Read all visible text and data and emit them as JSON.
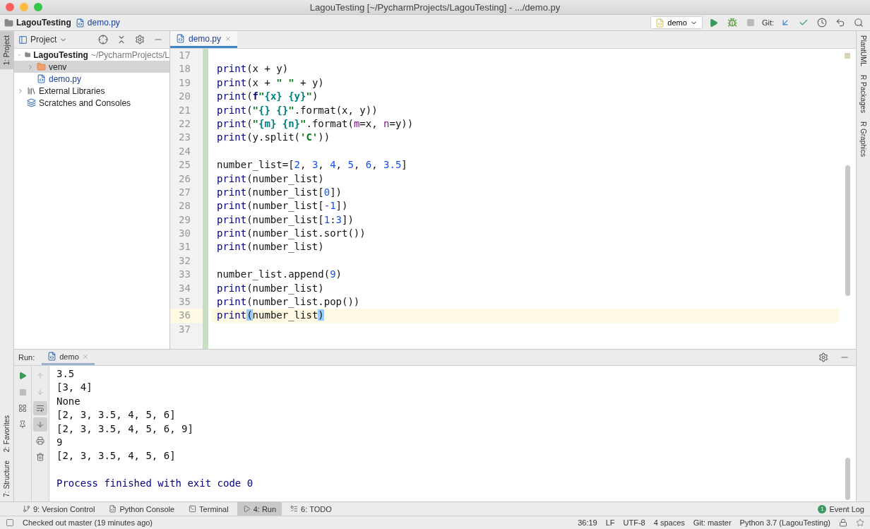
{
  "window": {
    "title": "LagouTesting [~/PycharmProjects/LagouTesting] - .../demo.py"
  },
  "nav_bar": {
    "breadcrumbs": [
      {
        "label": "LagouTesting",
        "kind": "folder"
      },
      {
        "label": "demo.py",
        "kind": "file"
      }
    ],
    "run_config": "demo",
    "git_label": "Git:"
  },
  "left_strip": [
    {
      "label": "1: Project",
      "selected": true,
      "kind": "top"
    },
    {
      "label": "2: Favorites",
      "selected": false,
      "kind": "bottom"
    },
    {
      "label": "7: Structure",
      "selected": false,
      "kind": "bottom"
    }
  ],
  "right_strip": [
    {
      "label": "PlantUML"
    },
    {
      "label": "R Packages"
    },
    {
      "label": "R Graphics"
    }
  ],
  "project_panel": {
    "title": "Project",
    "tree": [
      {
        "label": "LagouTesting",
        "path": "~/PycharmProjects/L",
        "kind": "project",
        "expanded": true,
        "selected": false,
        "children": [
          {
            "label": "venv",
            "kind": "folder",
            "expanded": false,
            "selected": true
          },
          {
            "label": "demo.py",
            "kind": "file",
            "selected": false
          }
        ]
      },
      {
        "label": "External Libraries",
        "kind": "library",
        "expanded": false,
        "selected": false
      },
      {
        "label": "Scratches and Consoles",
        "kind": "scratch",
        "selected": false
      }
    ]
  },
  "editor": {
    "tabs": [
      {
        "label": "demo.py",
        "selected": true
      }
    ],
    "lines": [
      {
        "number": "17",
        "current": false
      },
      {
        "number": "18",
        "current": false,
        "tokens": [
          {
            "text": "print",
            "kind": "builtin"
          },
          {
            "text": "(x + y)",
            "kind": "plain"
          }
        ]
      },
      {
        "number": "19",
        "current": false,
        "tokens": [
          {
            "text": "print",
            "kind": "builtin"
          },
          {
            "text": "(x + ",
            "kind": "plain"
          },
          {
            "text": "\" \"",
            "kind": "string"
          },
          {
            "text": " + y)",
            "kind": "plain"
          }
        ]
      },
      {
        "number": "20",
        "current": false,
        "tokens": [
          {
            "text": "print",
            "kind": "builtin"
          },
          {
            "text": "(",
            "kind": "plain"
          },
          {
            "text": "f",
            "kind": "fprefix"
          },
          {
            "text": "\"",
            "kind": "string"
          },
          {
            "text": "{x} {y}",
            "kind": "brace"
          },
          {
            "text": "\"",
            "kind": "string"
          },
          {
            "text": ")",
            "kind": "plain"
          }
        ]
      },
      {
        "number": "21",
        "current": false,
        "tokens": [
          {
            "text": "print",
            "kind": "builtin"
          },
          {
            "text": "(",
            "kind": "plain"
          },
          {
            "text": "\"",
            "kind": "string"
          },
          {
            "text": "{} {}",
            "kind": "brace"
          },
          {
            "text": "\"",
            "kind": "string"
          },
          {
            "text": ".format(x, y))",
            "kind": "plain"
          }
        ]
      },
      {
        "number": "22",
        "current": false,
        "tokens": [
          {
            "text": "print",
            "kind": "builtin"
          },
          {
            "text": "(",
            "kind": "plain"
          },
          {
            "text": "\"",
            "kind": "string"
          },
          {
            "text": "{m} {n}",
            "kind": "brace"
          },
          {
            "text": "\"",
            "kind": "string"
          },
          {
            "text": ".format(",
            "kind": "plain"
          },
          {
            "text": "m",
            "kind": "param"
          },
          {
            "text": "=x, ",
            "kind": "plain"
          },
          {
            "text": "n",
            "kind": "param"
          },
          {
            "text": "=y))",
            "kind": "plain"
          }
        ]
      },
      {
        "number": "23",
        "current": false,
        "tokens": [
          {
            "text": "print",
            "kind": "builtin"
          },
          {
            "text": "(y.split(",
            "kind": "plain"
          },
          {
            "text": "'C'",
            "kind": "string"
          },
          {
            "text": "))",
            "kind": "plain"
          }
        ]
      },
      {
        "number": "24",
        "current": false
      },
      {
        "number": "25",
        "current": false,
        "tokens": [
          {
            "text": "number_list=[",
            "kind": "plain"
          },
          {
            "text": "2",
            "kind": "number"
          },
          {
            "text": ", ",
            "kind": "plain"
          },
          {
            "text": "3",
            "kind": "number"
          },
          {
            "text": ", ",
            "kind": "plain"
          },
          {
            "text": "4",
            "kind": "number"
          },
          {
            "text": ", ",
            "kind": "plain"
          },
          {
            "text": "5",
            "kind": "number"
          },
          {
            "text": ", ",
            "kind": "plain"
          },
          {
            "text": "6",
            "kind": "number"
          },
          {
            "text": ", ",
            "kind": "plain"
          },
          {
            "text": "3.5",
            "kind": "number"
          },
          {
            "text": "]",
            "kind": "plain"
          }
        ]
      },
      {
        "number": "26",
        "current": false,
        "tokens": [
          {
            "text": "print",
            "kind": "builtin"
          },
          {
            "text": "(number_list)",
            "kind": "plain"
          }
        ]
      },
      {
        "number": "27",
        "current": false,
        "tokens": [
          {
            "text": "print",
            "kind": "builtin"
          },
          {
            "text": "(number_list[",
            "kind": "plain"
          },
          {
            "text": "0",
            "kind": "number"
          },
          {
            "text": "])",
            "kind": "plain"
          }
        ]
      },
      {
        "number": "28",
        "current": false,
        "tokens": [
          {
            "text": "print",
            "kind": "builtin"
          },
          {
            "text": "(number_list[",
            "kind": "plain"
          },
          {
            "text": "-1",
            "kind": "number"
          },
          {
            "text": "])",
            "kind": "plain"
          }
        ]
      },
      {
        "number": "29",
        "current": false,
        "tokens": [
          {
            "text": "print",
            "kind": "builtin"
          },
          {
            "text": "(number_list[",
            "kind": "plain"
          },
          {
            "text": "1",
            "kind": "number"
          },
          {
            "text": ":",
            "kind": "plain"
          },
          {
            "text": "3",
            "kind": "number"
          },
          {
            "text": "])",
            "kind": "plain"
          }
        ]
      },
      {
        "number": "30",
        "current": false,
        "tokens": [
          {
            "text": "print",
            "kind": "builtin"
          },
          {
            "text": "(number_list.sort())",
            "kind": "plain"
          }
        ]
      },
      {
        "number": "31",
        "current": false,
        "tokens": [
          {
            "text": "print",
            "kind": "builtin"
          },
          {
            "text": "(number_list)",
            "kind": "plain"
          }
        ]
      },
      {
        "number": "32",
        "current": false
      },
      {
        "number": "33",
        "current": false,
        "tokens": [
          {
            "text": "number_list.append(",
            "kind": "plain"
          },
          {
            "text": "9",
            "kind": "number"
          },
          {
            "text": ")",
            "kind": "plain"
          }
        ]
      },
      {
        "number": "34",
        "current": false,
        "tokens": [
          {
            "text": "print",
            "kind": "builtin"
          },
          {
            "text": "(number_list)",
            "kind": "plain"
          }
        ]
      },
      {
        "number": "35",
        "current": false,
        "tokens": [
          {
            "text": "print",
            "kind": "builtin"
          },
          {
            "text": "(number_list.pop())",
            "kind": "plain"
          }
        ]
      },
      {
        "number": "36",
        "current": true,
        "tokens": [
          {
            "text": "print",
            "kind": "builtin"
          },
          {
            "text": "(",
            "kind": "match"
          },
          {
            "text": "number_list",
            "kind": "plain"
          },
          {
            "text": ")",
            "kind": "match"
          }
        ]
      },
      {
        "number": "37",
        "current": false
      }
    ]
  },
  "run_panel": {
    "label": "Run:",
    "tabs": [
      {
        "label": "demo",
        "selected": true
      }
    ],
    "output": [
      {
        "text": "3.5",
        "kind": "stdout"
      },
      {
        "text": "[3, 4]",
        "kind": "stdout"
      },
      {
        "text": "None",
        "kind": "stdout"
      },
      {
        "text": "[2, 3, 3.5, 4, 5, 6]",
        "kind": "stdout"
      },
      {
        "text": "[2, 3, 3.5, 4, 5, 6, 9]",
        "kind": "stdout"
      },
      {
        "text": "9",
        "kind": "stdout"
      },
      {
        "text": "[2, 3, 3.5, 4, 5, 6]",
        "kind": "stdout"
      },
      {
        "kind": "blank"
      },
      {
        "text": "Process finished with exit code 0",
        "kind": "system"
      }
    ]
  },
  "tool_tabs": [
    {
      "label": "9: Version Control",
      "kind": "vcs",
      "selected": false
    },
    {
      "label": "Python Console",
      "kind": "console",
      "selected": false
    },
    {
      "label": "Terminal",
      "kind": "terminal",
      "selected": false
    },
    {
      "label": "4: Run",
      "kind": "run",
      "selected": true
    },
    {
      "label": "6: TODO",
      "kind": "todo",
      "selected": false
    }
  ],
  "event_log": {
    "label": "Event Log",
    "badge": "1"
  },
  "status_bar": {
    "message": "Checked out master (19 minutes ago)",
    "items": [
      "36:19",
      "LF",
      "UTF-8",
      "4 spaces",
      "Git: master",
      "Python 3.7 (LagouTesting)"
    ]
  }
}
